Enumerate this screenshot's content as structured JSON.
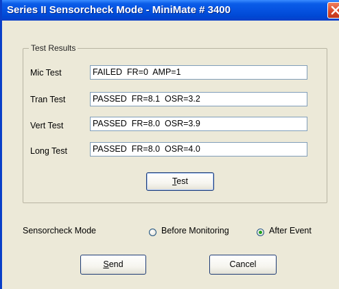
{
  "window": {
    "title": "Series II Sensorcheck Mode - MiniMate # 3400"
  },
  "test_results": {
    "group_label": "Test Results",
    "rows": [
      {
        "label": "Mic Test",
        "value": "FAILED  FR=0  AMP=1"
      },
      {
        "label": "Tran Test",
        "value": "PASSED  FR=8.1  OSR=3.2"
      },
      {
        "label": "Vert Test",
        "value": "PASSED  FR=8.0  OSR=3.9"
      },
      {
        "label": "Long Test",
        "value": "PASSED  FR=8.0  OSR=4.0"
      }
    ],
    "test_button": {
      "mnemonic": "T",
      "rest": "est"
    }
  },
  "sensorcheck_mode": {
    "label": "Sensorcheck Mode",
    "options": [
      {
        "label": "Before Monitoring",
        "selected": false
      },
      {
        "label": "After Event",
        "selected": true
      }
    ]
  },
  "buttons": {
    "send": {
      "mnemonic": "S",
      "rest": "end"
    },
    "cancel": {
      "label": "Cancel"
    }
  },
  "colors": {
    "titlebar": "#0552e0",
    "dialog_bg": "#ece9d8",
    "close_button": "#d74526",
    "radio_dot": "#21a121"
  },
  "icons": {
    "close": "close-icon"
  }
}
